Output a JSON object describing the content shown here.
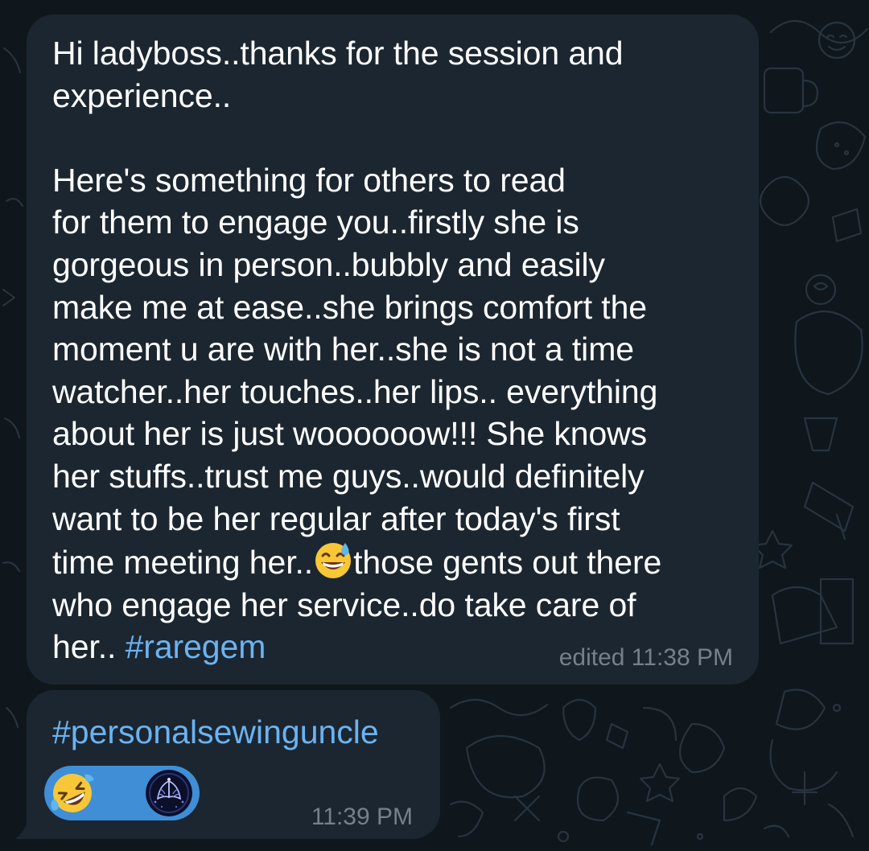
{
  "theme": {
    "bubble_color": "#1c2630",
    "text_color": "#ffffff",
    "hashtag_color": "#6ab3f2",
    "timestamp_color": "#76808a",
    "reaction_color": "#3f8ed6",
    "background_color": "#0f161c"
  },
  "messages": [
    {
      "lines": {
        "l1": "Hi ladyboss..thanks for the session and",
        "l2": "experience..",
        "l3": "",
        "l4": "Here's something for others to read",
        "l5": "for them to engage you..firstly she is",
        "l6": "gorgeous in person..bubbly and easily",
        "l7": "make me at ease..she brings comfort the",
        "l8": "moment u are with her..she is not a time",
        "l9": "watcher..her touches..her lips.. everything",
        "l10": "about her is just woooooow!!! She knows",
        "l11": "her stuffs..trust me guys..would definitely",
        "l12": "want to be her regular after today's first",
        "l13a": "time meeting her..",
        "l13b": "those gents out there",
        "l14": "who engage her service..do take care of",
        "l15a": "her.. ",
        "l15b": "#raregem"
      },
      "inline_emoji": "grinning-face-with-sweat",
      "timestamp": "edited 11:38 PM"
    },
    {
      "hashtag": "#personalsewinguncle",
      "reactions": [
        {
          "emoji": "rolling-on-the-floor-laughing"
        },
        {
          "type": "user-avatar"
        }
      ],
      "timestamp": "11:39 PM"
    }
  ]
}
